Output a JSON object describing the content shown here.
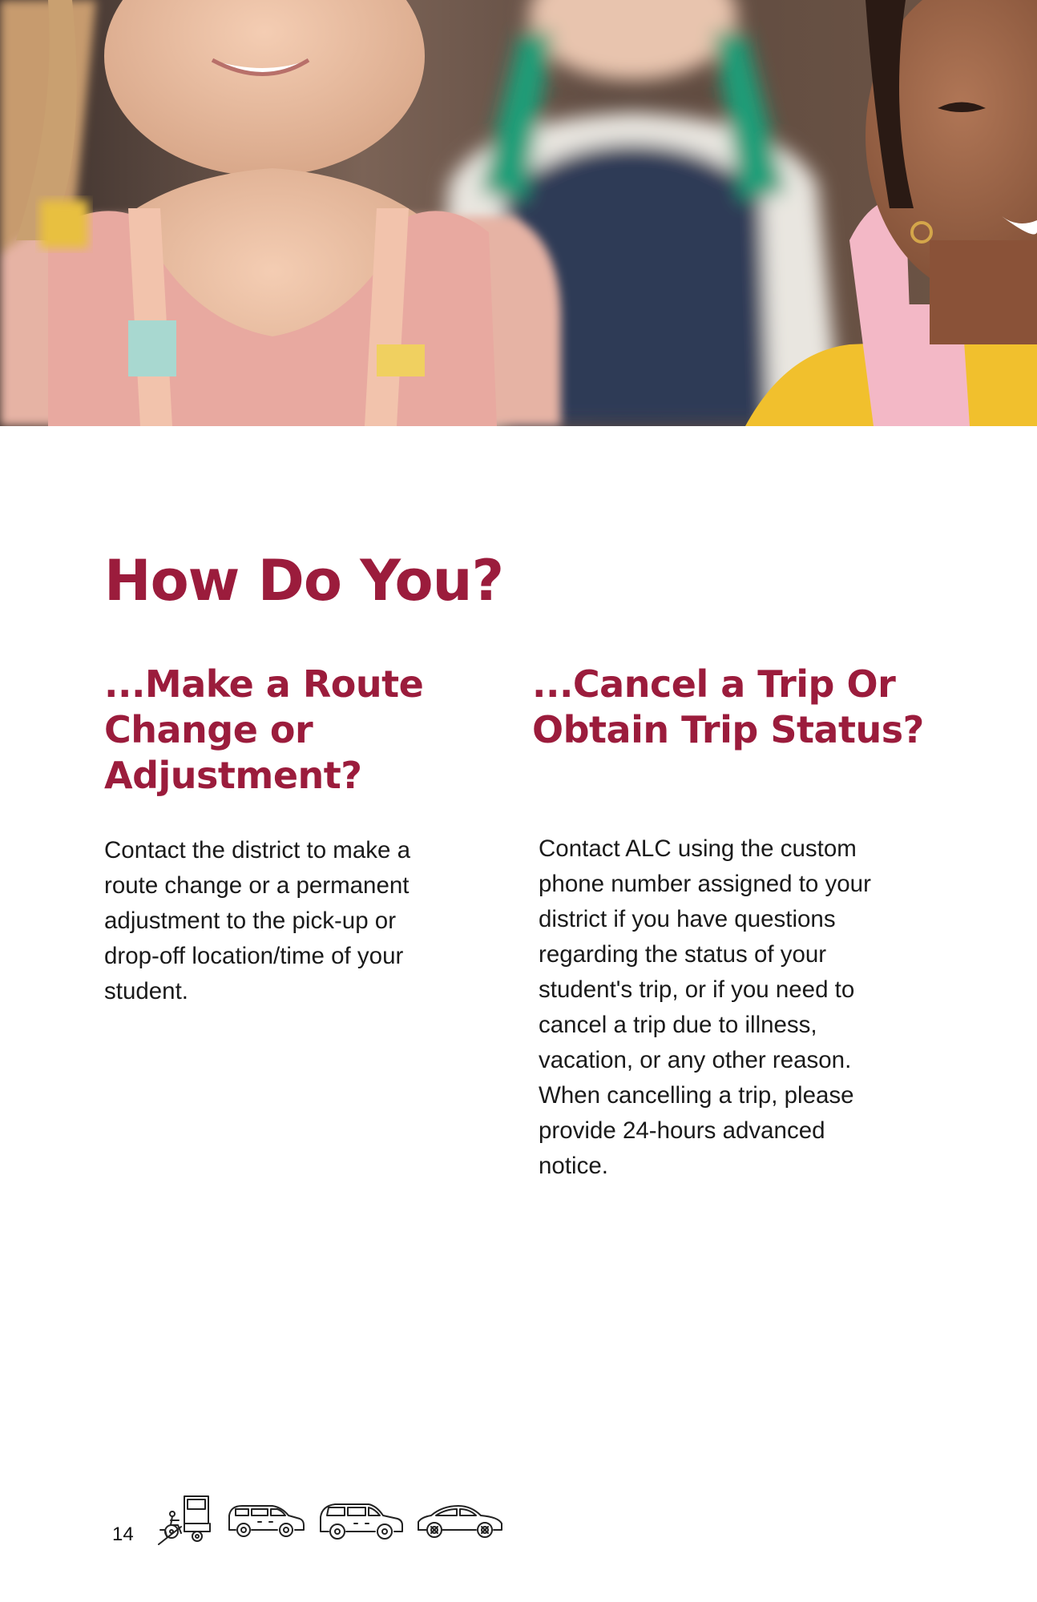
{
  "page": {
    "title": "How Do You?",
    "page_number": "14"
  },
  "sections": [
    {
      "heading_lines": [
        "...Make a Route",
        "Change or",
        "Adjustment?"
      ],
      "body_lines": [
        "Contact the district to make a",
        "route change or a permanent",
        "adjustment to the pick-up or",
        "drop-off location/time of your",
        "student."
      ]
    },
    {
      "heading_lines": [
        "...Cancel a Trip Or",
        "Obtain Trip Status?"
      ],
      "body_lines": [
        "Contact ALC using the custom",
        "phone number assigned to your",
        "district if you have questions",
        "regarding the status of your",
        "student's trip, or if you need to",
        "cancel a trip due to illness,",
        "vacation, or any other reason.",
        "When cancelling a trip, please",
        "provide 24-hours advanced",
        "notice."
      ]
    }
  ],
  "footer": {
    "icons": [
      "wheelchair-van-icon",
      "minivan-icon",
      "suv-icon",
      "sedan-icon"
    ]
  },
  "colors": {
    "accent": "#9b1c3c",
    "text": "#1a1a1a",
    "background": "#ffffff"
  }
}
